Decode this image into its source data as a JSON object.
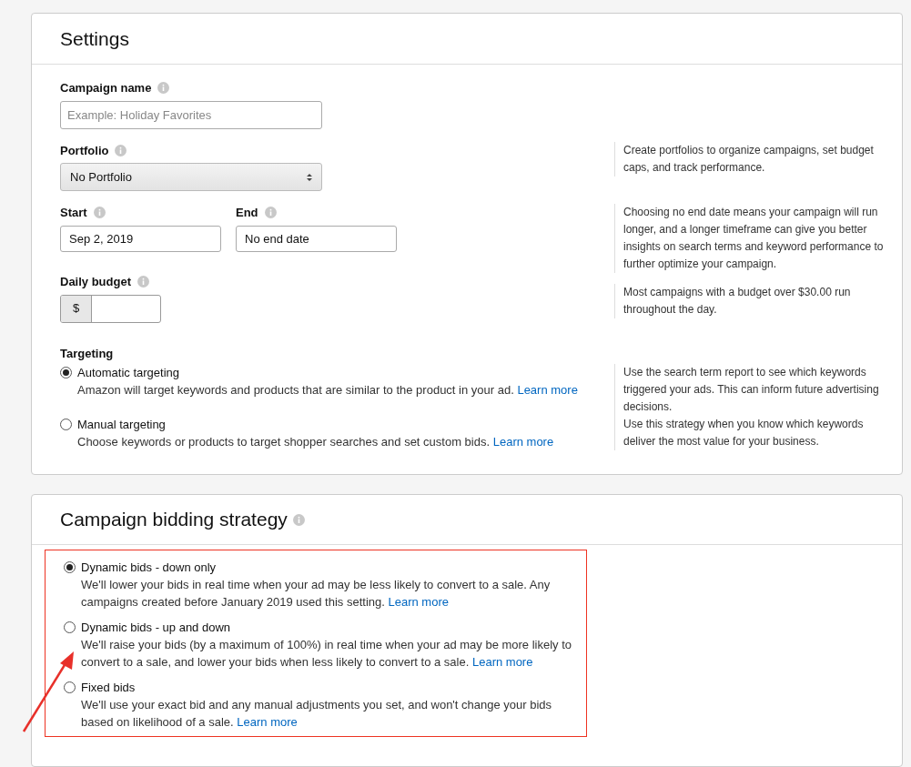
{
  "settings": {
    "title": "Settings",
    "fields": [
      {
        "kind": "text",
        "label": "Campaign name",
        "placeholder": "Example: Holiday Favorites"
      },
      {
        "kind": "select",
        "label": "Portfolio",
        "value": "No Portfolio",
        "hint": "Create portfolios to organize campaigns, set budget caps, and track performance."
      },
      {
        "kind": "dates",
        "start": {
          "label": "Start",
          "value": "Sep 2, 2019"
        },
        "end": {
          "label": "End",
          "value": "No end date"
        },
        "hint": "Choosing no end date means your campaign will run longer, and a longer timeframe can give you better insights on search terms and keyword performance to further optimize your campaign."
      },
      {
        "kind": "budget",
        "label": "Daily budget",
        "prefix": "$",
        "hint": "Most campaigns with a budget over $30.00 run throughout the day."
      }
    ],
    "targeting": {
      "label": "Targeting",
      "options": [
        {
          "label": "Automatic targeting",
          "description": "Amazon will target keywords and products that are similar to the product in your ad.",
          "link": "Learn more",
          "selected": true,
          "hint": "Use the search term report to see which keywords triggered your ads. This can inform future advertising decisions."
        },
        {
          "label": "Manual targeting",
          "description": "Choose keywords or products to target shopper searches and set custom bids.",
          "link": "Learn more",
          "selected": false,
          "hint": "Use this strategy when you know which keywords deliver the most value for your business."
        }
      ]
    }
  },
  "bidding": {
    "title": "Campaign bidding strategy",
    "options": [
      {
        "label": "Dynamic bids - down only",
        "description": "We'll lower your bids in real time when your ad may be less likely to convert to a sale. Any campaigns created before January 2019 used this setting.",
        "link": "Learn more",
        "selected": true
      },
      {
        "label": "Dynamic bids - up and down",
        "description": "We'll raise your bids (by a maximum of 100%) in real time when your ad may be more likely to convert to a sale, and lower your bids when less likely to convert to a sale.",
        "link": "Learn more",
        "selected": false
      },
      {
        "label": "Fixed bids",
        "description": "We'll use your exact bid and any manual adjustments you set, and won't change your bids based on likelihood of a sale.",
        "link": "Learn more",
        "selected": false
      }
    ]
  }
}
